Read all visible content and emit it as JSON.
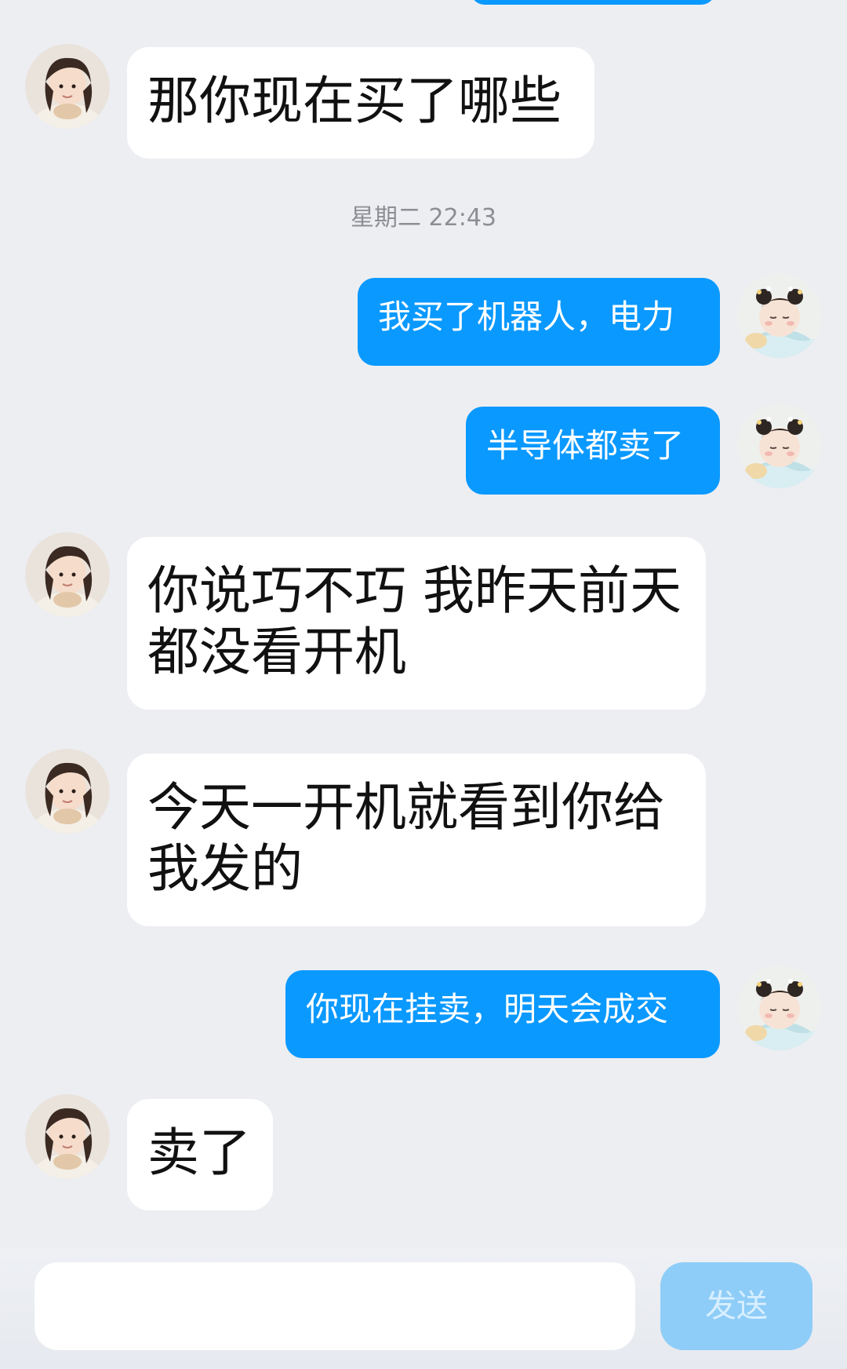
{
  "messages": [
    {
      "side": "in",
      "text": "那你现在买了哪些"
    },
    {
      "side": "out",
      "text": "我买了机器人，电力"
    },
    {
      "side": "out",
      "text": "半导体都卖了"
    },
    {
      "side": "in",
      "text": "你说巧不巧 我昨天前天都没看开机"
    },
    {
      "side": "in",
      "text": "今天一开机就看到你给我发的"
    },
    {
      "side": "out",
      "text": "你现在挂卖，明天会成交"
    },
    {
      "side": "in",
      "text": "卖了"
    }
  ],
  "timestamp": "星期二 22:43",
  "composer": {
    "input_value": "",
    "send_label": "发送"
  },
  "colors": {
    "background": "#edeef2",
    "outgoing_bubble": "#0a99ff",
    "incoming_bubble": "#ffffff",
    "send_button": "#8ecdf8"
  },
  "avatars": {
    "incoming": "girl-photo-avatar",
    "outgoing": "baby-costume-avatar"
  }
}
